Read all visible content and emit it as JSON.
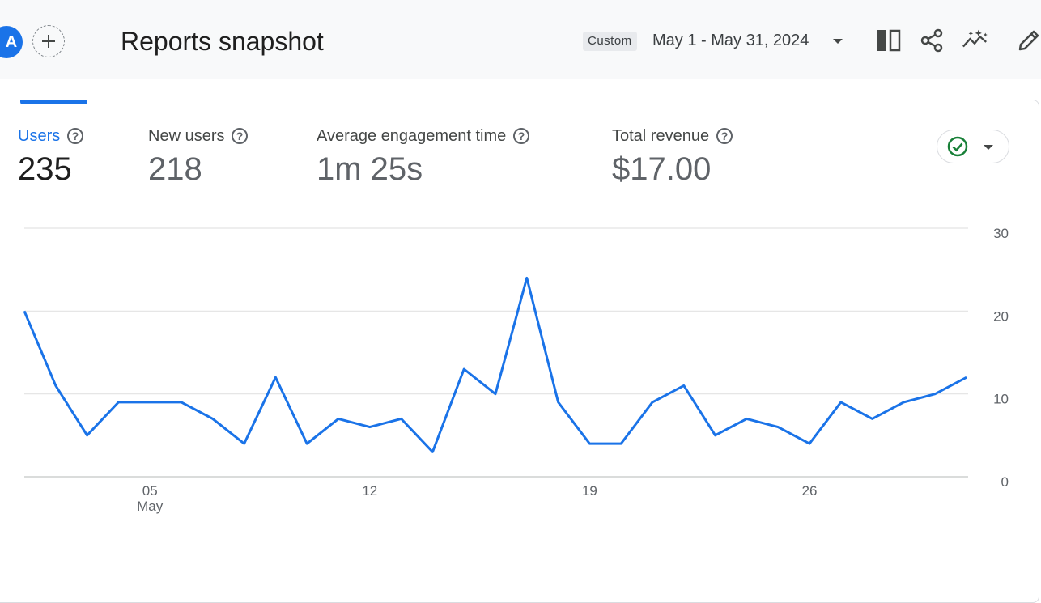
{
  "header": {
    "avatar_letter": "A",
    "title": "Reports snapshot",
    "date_chip": "Custom",
    "date_range": "May 1 - May 31, 2024",
    "icons": [
      "add-comparison-icon",
      "compare-columns-icon",
      "share-icon",
      "insights-icon",
      "edit-icon"
    ]
  },
  "metrics": [
    {
      "label": "Users",
      "value": "235",
      "active": true
    },
    {
      "label": "New users",
      "value": "218",
      "active": false
    },
    {
      "label": "Average engagement time",
      "value": "1m 25s",
      "active": false
    },
    {
      "label": "Total revenue",
      "value": "$17.00",
      "active": false
    }
  ],
  "colors": {
    "accent": "#1a73e8",
    "line": "#1a73e8",
    "check": "#188038"
  },
  "chart_data": {
    "type": "line",
    "x": [
      "2024-05-01",
      "2024-05-02",
      "2024-05-03",
      "2024-05-04",
      "2024-05-05",
      "2024-05-06",
      "2024-05-07",
      "2024-05-08",
      "2024-05-09",
      "2024-05-10",
      "2024-05-11",
      "2024-05-12",
      "2024-05-13",
      "2024-05-14",
      "2024-05-15",
      "2024-05-16",
      "2024-05-17",
      "2024-05-18",
      "2024-05-19",
      "2024-05-20",
      "2024-05-21",
      "2024-05-22",
      "2024-05-23",
      "2024-05-24",
      "2024-05-25",
      "2024-05-26",
      "2024-05-27",
      "2024-05-28",
      "2024-05-29",
      "2024-05-30",
      "2024-05-31"
    ],
    "series": [
      {
        "values": [
          20,
          11,
          5,
          9,
          9,
          9,
          7,
          4,
          12,
          4,
          7,
          6,
          7,
          3,
          13,
          10,
          24,
          9,
          4,
          4,
          9,
          11,
          5,
          7,
          6,
          4,
          9,
          7,
          9,
          10,
          12
        ]
      }
    ],
    "ylim": [
      0,
      30
    ],
    "y_ticks": [
      "0",
      "10",
      "20",
      "30"
    ],
    "x_tick_labels": [
      {
        "day": 5,
        "label": "05",
        "sublabel": "May"
      },
      {
        "day": 12,
        "label": "12"
      },
      {
        "day": 19,
        "label": "19"
      },
      {
        "day": 26,
        "label": "26"
      }
    ],
    "y_axis_side": "right",
    "grid": true
  }
}
